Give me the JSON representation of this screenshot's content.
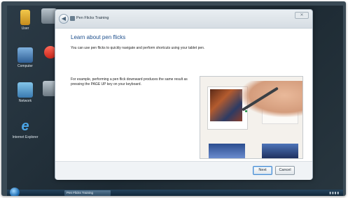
{
  "window": {
    "title": "Pen Flicks Training",
    "close_glyph": "✕"
  },
  "content": {
    "heading": "Learn about pen flicks",
    "intro": "You can use pen flicks to quickly navigate and perform shortcuts using your tablet pen.",
    "example": "For example, performing a pen flick downward produces the same result as pressing the PAGE UP key on your keyboard."
  },
  "buttons": {
    "next": "Next",
    "cancel": "Cancel"
  },
  "desktop_icons": [
    {
      "label": "User",
      "icon": "user-folder-icon"
    },
    {
      "label": "Computer",
      "icon": "computer-icon"
    },
    {
      "label": "Network",
      "icon": "network-icon"
    },
    {
      "label": "Internet Explorer",
      "icon": "internet-explorer-icon"
    }
  ],
  "taskbar": {
    "active_item": "Pen Flicks Training"
  },
  "colors": {
    "heading": "#1e4f8c",
    "desktop": "#2b3a46"
  }
}
